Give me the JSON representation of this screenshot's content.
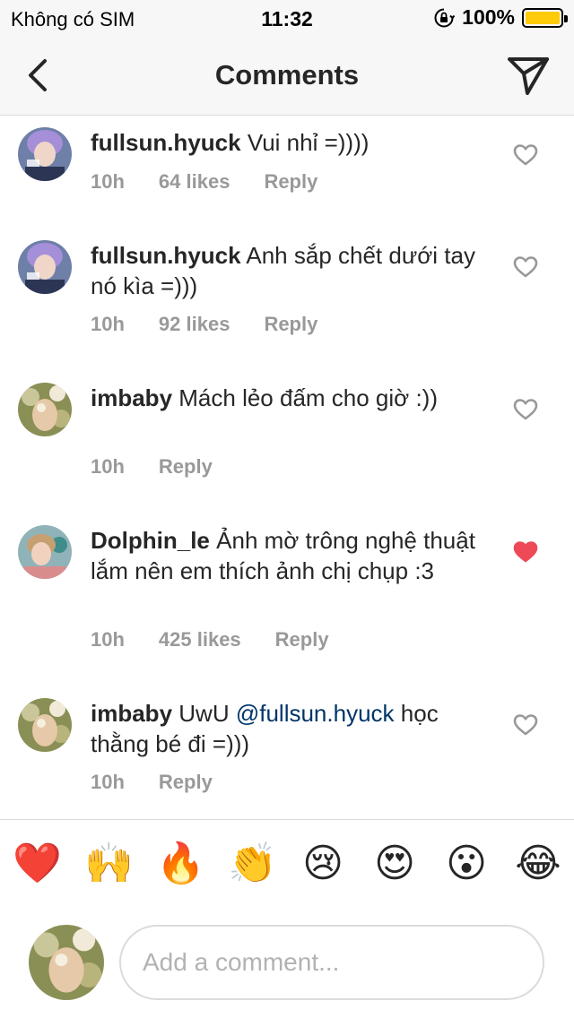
{
  "status_bar": {
    "carrier": "Không có SIM",
    "time": "11:32",
    "battery": "100%"
  },
  "header": {
    "title": "Comments",
    "back_icon": "chevron-left-icon",
    "send_icon": "paper-plane-icon"
  },
  "comments": [
    {
      "username": "fullsun.hyuck",
      "text": "Vui nhỉ =))))",
      "time": "10h",
      "likes": "64 likes",
      "reply": "Reply",
      "liked": false
    },
    {
      "username": "fullsun.hyuck",
      "text": "Anh sắp chết dưới tay nó kìa =)))",
      "time": "10h",
      "likes": "92 likes",
      "reply": "Reply",
      "liked": false
    },
    {
      "username": "imbaby",
      "text": "Mách lẻo đấm cho giờ :))",
      "time": "10h",
      "reply": "Reply",
      "liked": false
    },
    {
      "username": "Dolphin_le",
      "text": "Ảnh mờ trông nghệ thuật lắm nên em thích ảnh chị chụp :3",
      "time": "10h",
      "likes": "425 likes",
      "reply": "Reply",
      "liked": true
    },
    {
      "username": "imbaby",
      "text_before": "UwU",
      "mention": "@fullsun.hyuck",
      "text_after": "học thằng bé đi =)))",
      "time": "10h",
      "reply": "Reply",
      "liked": false
    }
  ],
  "emoji_bar": [
    "❤️",
    "🙌",
    "🔥",
    "👏",
    "😢",
    "😍",
    "😮",
    "😂"
  ],
  "compose": {
    "placeholder": "Add a comment..."
  },
  "colors": {
    "liked_heart": "#ed4956",
    "mention": "#003569",
    "meta": "#999999",
    "battery": "#fdcb0a"
  }
}
